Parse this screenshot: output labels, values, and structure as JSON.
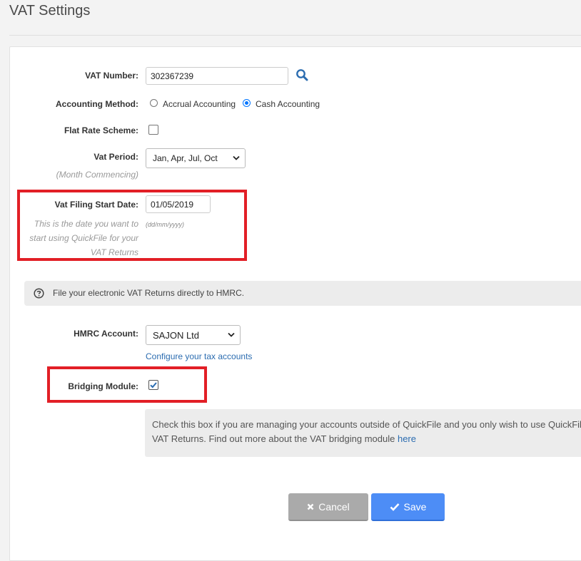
{
  "page": {
    "title": "VAT Settings"
  },
  "form": {
    "vat_number": {
      "label": "VAT Number:",
      "value": "302367239"
    },
    "accounting_method": {
      "label": "Accounting Method:",
      "options": [
        {
          "label": "Accrual Accounting",
          "checked": false
        },
        {
          "label": "Cash Accounting",
          "checked": true
        }
      ]
    },
    "flat_rate": {
      "label": "Flat Rate Scheme:",
      "checked": false
    },
    "vat_period": {
      "label": "Vat Period:",
      "hint": "(Month Commencing)",
      "value": "Jan, Apr, Jul, Oct"
    },
    "filing_start": {
      "label": "Vat Filing Start Date:",
      "hint": "This is the date you want to start using QuickFile for your VAT Returns",
      "value": "01/05/2019",
      "format_hint": "(dd/mm/yyyy)"
    }
  },
  "info": {
    "text": "File your electronic VAT Returns directly to HMRC."
  },
  "hmrc": {
    "label": "HMRC Account:",
    "value": "SAJON Ltd",
    "configure_link": "Configure your tax accounts"
  },
  "bridging": {
    "label": "Bridging Module:",
    "checked": true,
    "note": "Check this box if you are managing your accounts outside of QuickFile and you only wish to use QuickFil VAT Returns. Find out more about the VAT bridging module ",
    "note_link": "here"
  },
  "buttons": {
    "cancel": "Cancel",
    "save": "Save"
  },
  "colors": {
    "accent": "#4d8df6",
    "highlight": "#e21f26",
    "link": "#2b6cb0"
  },
  "icons": [
    "search-icon",
    "question-circle-icon",
    "chevron-down-icon",
    "check-icon",
    "close-icon"
  ]
}
